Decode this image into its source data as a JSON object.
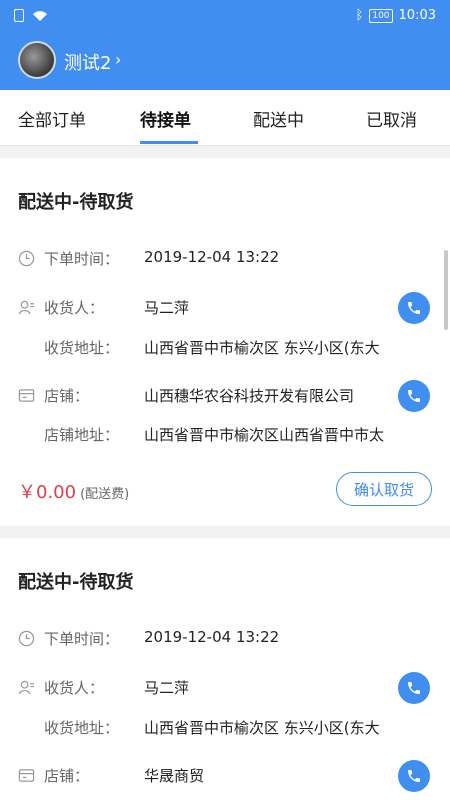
{
  "status_bar": {
    "time": "10:03",
    "battery": "100"
  },
  "header": {
    "username": "测试2",
    "chevron": "›"
  },
  "tabs": [
    {
      "label": "全部订单"
    },
    {
      "label": "待接单"
    },
    {
      "label": "配送中"
    },
    {
      "label": "已取消"
    }
  ],
  "orders": [
    {
      "title": "配送中-待取货",
      "order_time_label": "下单时间：",
      "order_time": "2019-12-04 13:22",
      "receiver_label": "收货人：",
      "receiver": "马二萍",
      "address_label": "收货地址：",
      "address": "山西省晋中市榆次区 东兴小区(东大",
      "shop_label": "店铺：",
      "shop": "山西穗华农谷科技开发有限公司",
      "shop_address_label": "店铺地址：",
      "shop_address": "山西省晋中市榆次区山西省晋中市太",
      "price": "￥0.00",
      "price_note": "(配送费)",
      "confirm_label": "确认取货"
    },
    {
      "title": "配送中-待取货",
      "order_time_label": "下单时间：",
      "order_time": "2019-12-04 13:22",
      "receiver_label": "收货人：",
      "receiver": "马二萍",
      "address_label": "收货地址：",
      "address": "山西省晋中市榆次区 东兴小区(东大",
      "shop_label": "店铺：",
      "shop": "华晟商贸"
    }
  ],
  "colors": {
    "primary": "#3f8ef0",
    "price": "#e0414a"
  }
}
